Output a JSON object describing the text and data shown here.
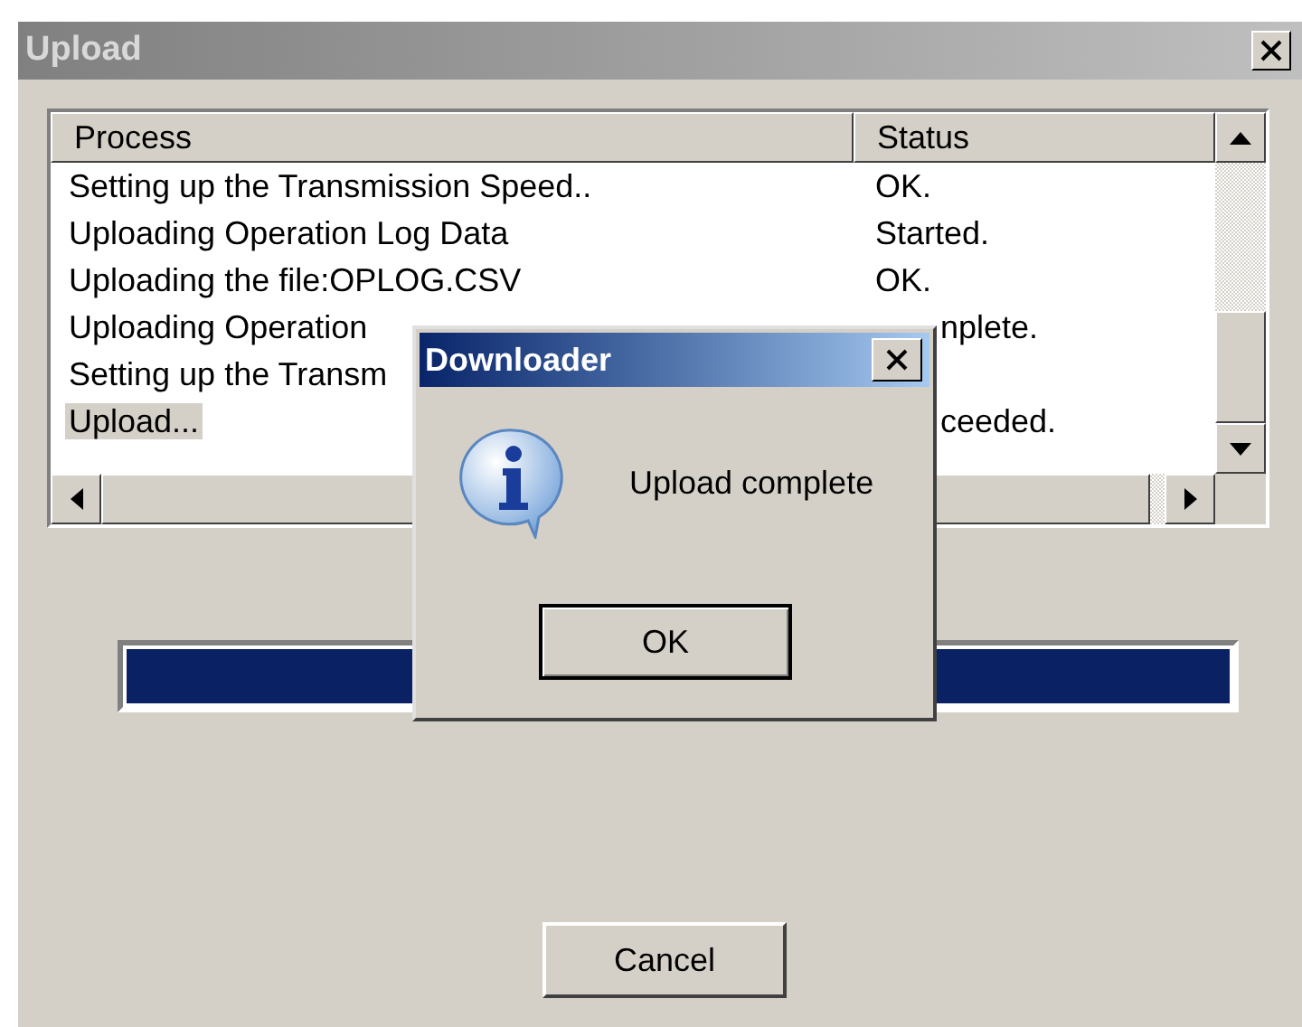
{
  "window": {
    "title": "Upload"
  },
  "list": {
    "columns": [
      "Process",
      "Status"
    ],
    "rows": [
      {
        "process": "Setting up the Transmission Speed..",
        "status": "OK.",
        "selected": false
      },
      {
        "process": "Uploading Operation Log Data",
        "status": "Started.",
        "selected": false
      },
      {
        "process": "Uploading the file:OPLOG.CSV",
        "status": "OK.",
        "selected": false
      },
      {
        "process": "Uploading Operation",
        "status": "nplete.",
        "selected": false
      },
      {
        "process": "Setting up the Transm",
        "selected": false
      },
      {
        "process": "Upload...",
        "status": "ceeded.",
        "selected": true
      }
    ]
  },
  "progress": {
    "level": 1
  },
  "cancel_button": "Cancel",
  "dialog": {
    "title": "Downloader",
    "message": "Upload complete",
    "button": "OK"
  }
}
